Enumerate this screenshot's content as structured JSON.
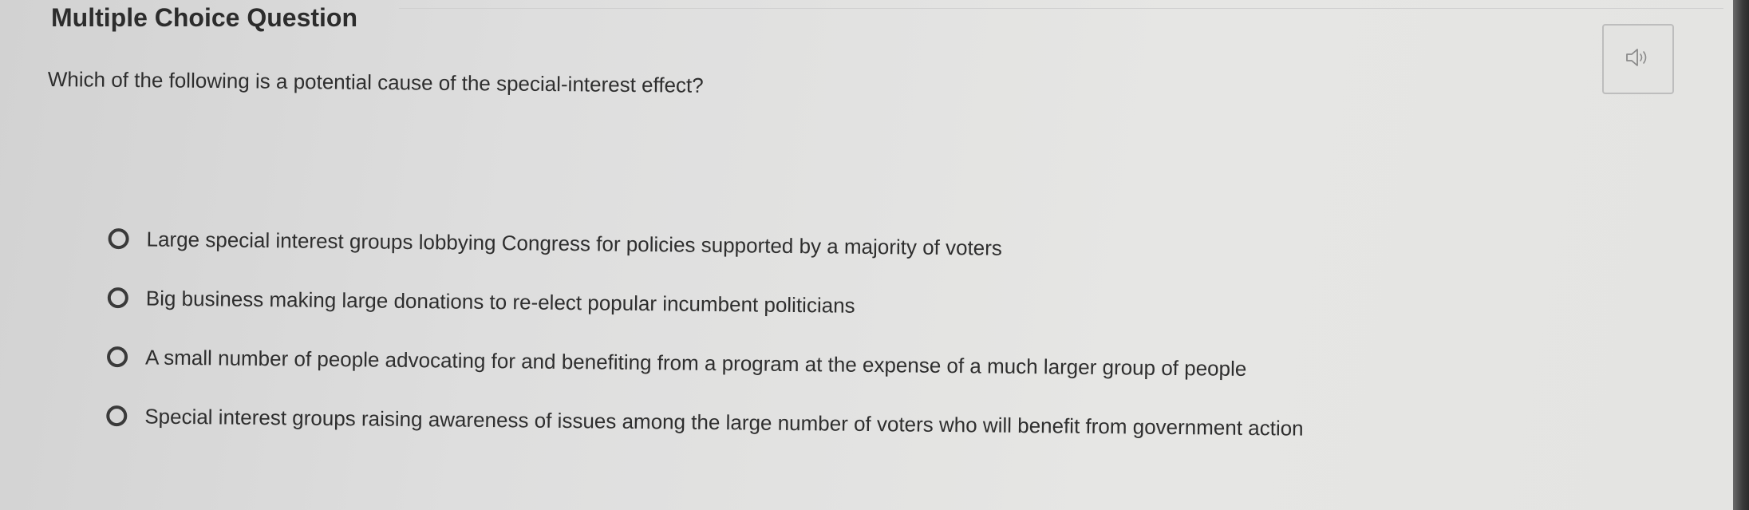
{
  "question": {
    "title": "Multiple Choice Question",
    "prompt": "Which of the following is a potential cause of the special-interest effect?"
  },
  "audio_button": {
    "icon": "speaker-icon"
  },
  "options": [
    {
      "label": "Large special interest groups lobbying Congress for policies supported by a majority of voters",
      "selected": false
    },
    {
      "label": "Big business making large donations to re-elect popular incumbent politicians",
      "selected": false
    },
    {
      "label": "A small number of people advocating for and benefiting from a program at the expense of a much larger group of people",
      "selected": false
    },
    {
      "label": "Special interest groups raising awareness of issues among the large number of voters who will benefit from government action",
      "selected": false
    }
  ]
}
